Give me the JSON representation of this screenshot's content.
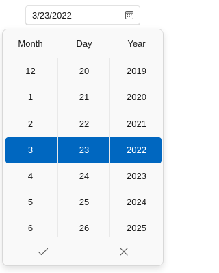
{
  "date_input": {
    "value": "3/23/2022",
    "icon": "calendar-icon"
  },
  "picker": {
    "headers": {
      "month": "Month",
      "day": "Day",
      "year": "Year"
    },
    "months": [
      "12",
      "1",
      "2",
      "3",
      "4",
      "5",
      "6"
    ],
    "days": [
      "20",
      "21",
      "22",
      "23",
      "24",
      "25",
      "26"
    ],
    "years": [
      "2019",
      "2020",
      "2021",
      "2022",
      "2023",
      "2024",
      "2025"
    ],
    "selected_index": 3,
    "accent_color": "#0067c0",
    "footer": {
      "accept_icon": "checkmark-icon",
      "dismiss_icon": "close-icon"
    }
  }
}
